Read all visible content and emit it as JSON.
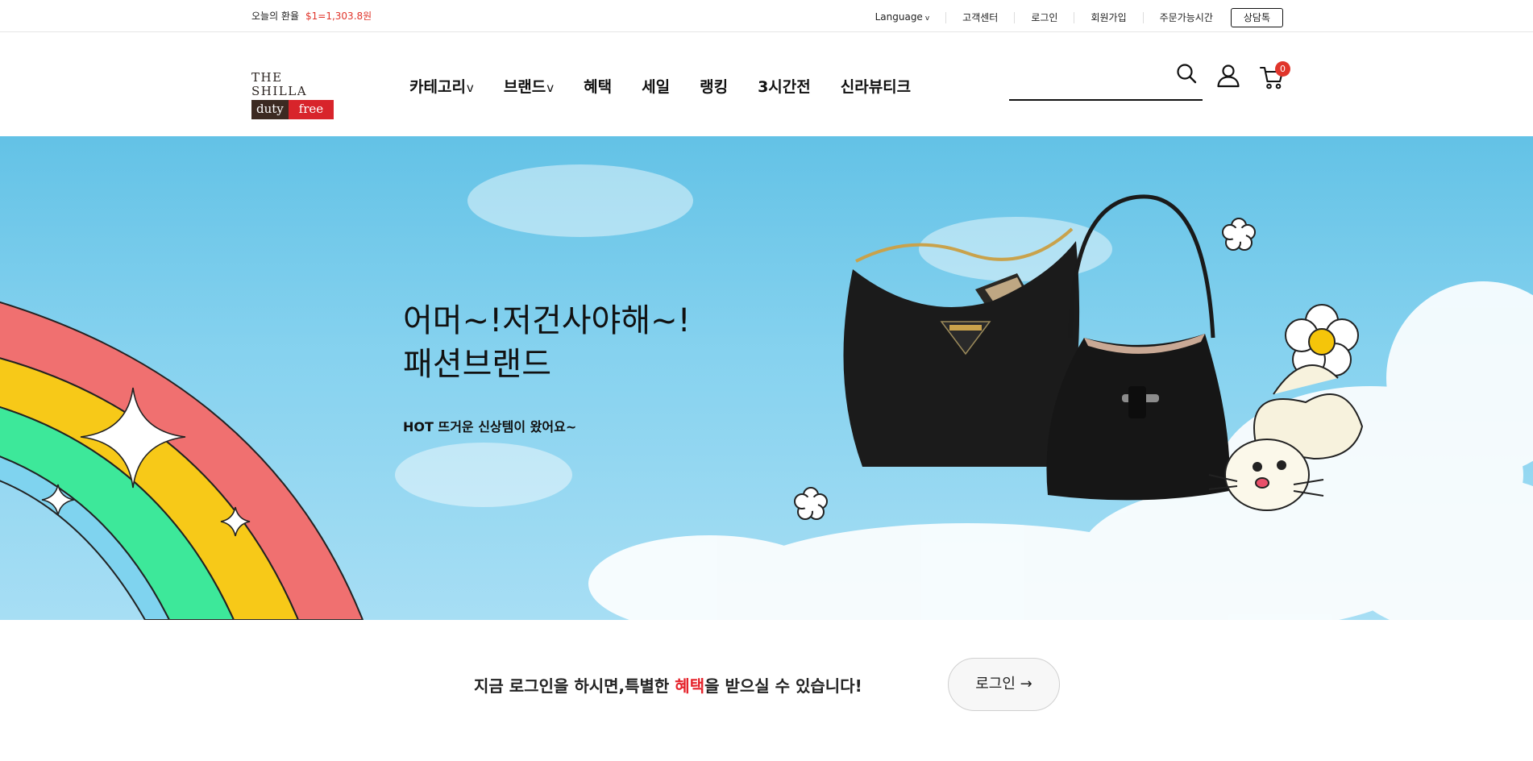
{
  "topbar": {
    "rate_label": "오늘의 환율",
    "rate_value": "$1=1,303.8원",
    "language": "Language",
    "customer_center": "고객센터",
    "login": "로그인",
    "signup": "회원가입",
    "order_hours": "주문가능시간",
    "consult_talk": "상담톡"
  },
  "logo": {
    "top": "THE SHILLA",
    "duty": "duty",
    "free": "free"
  },
  "gnb": {
    "items": [
      "카테고리",
      "브랜드",
      "혜택",
      "세일",
      "랭킹",
      "3시간전",
      "신라뷰티크"
    ],
    "dropdown_marker": "v"
  },
  "search": {
    "placeholder": "",
    "value": ""
  },
  "cart": {
    "count": "0"
  },
  "hero": {
    "title_line1": "어머~!저건사야해~!",
    "title_line2": "패션브랜드",
    "subtitle": "HOT 뜨거운 신상템이 왔어요~"
  },
  "login_promo": {
    "prefix": "지금 로그인을 하시면,특별한 ",
    "highlight": "혜택",
    "suffix": "을 받으실 수 있습니다!",
    "button": "로그인 →"
  },
  "colors": {
    "accent_red": "#e0352b",
    "brand_brown": "#3c2a22",
    "brand_red": "#d8242b",
    "sky": "#86d2ef"
  },
  "icons": [
    "chevron-down-icon",
    "search-icon",
    "user-icon",
    "cart-icon"
  ]
}
